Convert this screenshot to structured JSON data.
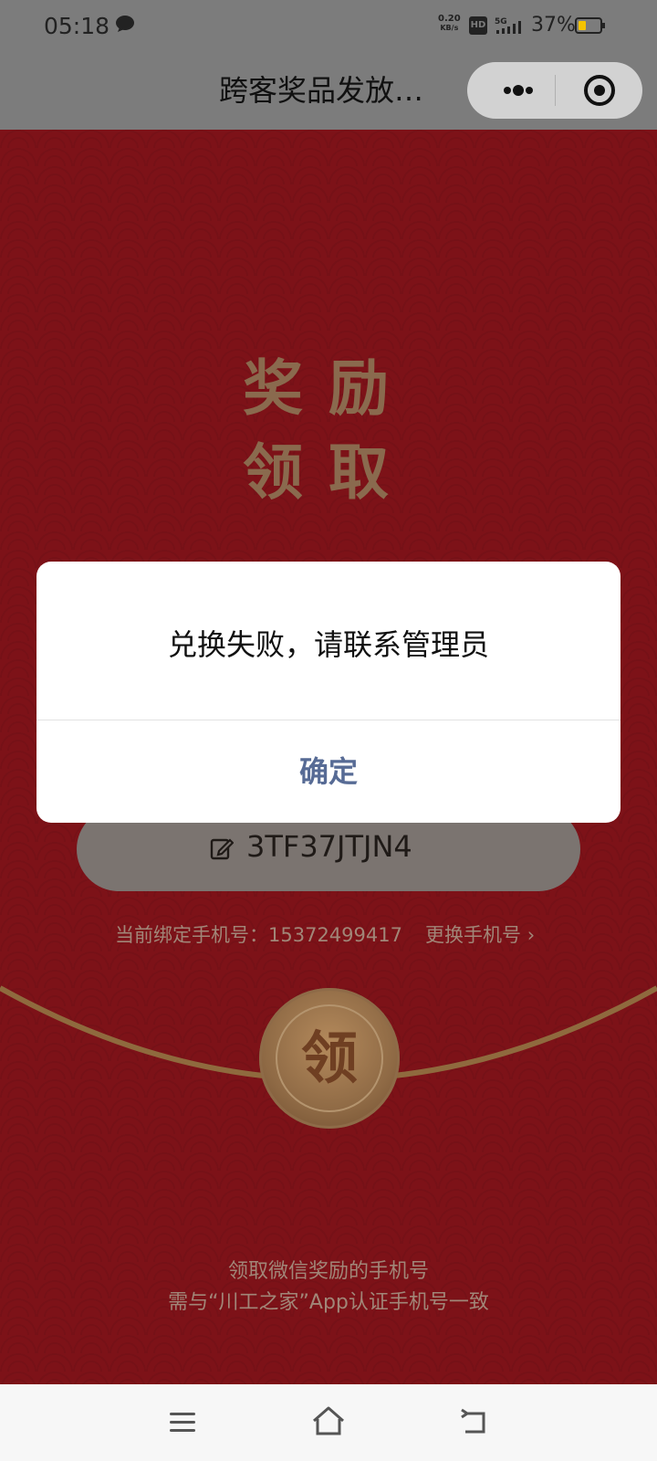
{
  "status_bar": {
    "time": "05:18",
    "net_speed_value": "0.20",
    "net_speed_unit": "KB/s",
    "hd_label": "HD",
    "network": "5G",
    "battery_percent": "37%",
    "battery_level": 0.37
  },
  "title_bar": {
    "title": "跨客奖品发放…"
  },
  "page": {
    "headline_line1": "奖励",
    "headline_line2": "领取",
    "code": "3TF37JTJN4",
    "bound_phone_label": "当前绑定手机号：15372499417",
    "change_phone": "更换手机号",
    "claim_button": "领",
    "footnote_line1": "领取微信奖励的手机号",
    "footnote_line2": "需与“川工之家”App认证手机号一致"
  },
  "dialog": {
    "message": "兑换失败，请联系管理员",
    "confirm_label": "确定"
  },
  "colors": {
    "background_red": "#7d1218",
    "gold": "#8a6a4e",
    "dialog_button": "#576b95"
  }
}
